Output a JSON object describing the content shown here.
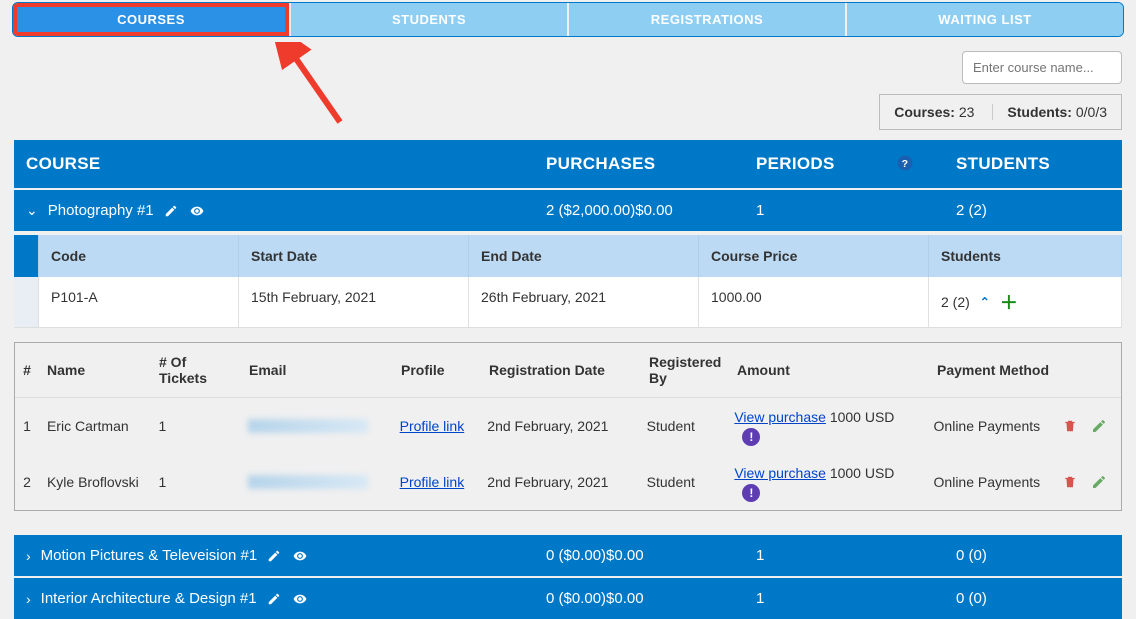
{
  "tabs": {
    "courses": "COURSES",
    "students": "STUDENTS",
    "registrations": "REGISTRATIONS",
    "waiting": "WAITING LIST"
  },
  "search_placeholder": "Enter course name...",
  "stats": {
    "courses_label": "Courses:",
    "courses": "23",
    "students_label": "Students:",
    "students": "0/0/3"
  },
  "headers": {
    "course": "COURSE",
    "purchases": "PURCHASES",
    "periods": "PERIODS",
    "students": "STUDENTS"
  },
  "photo": {
    "name": "Photography #1",
    "purchases": "2 ($2,000.00)$0.00",
    "periods": "1",
    "students": "2 (2)"
  },
  "subhead": {
    "code": "Code",
    "start": "Start Date",
    "end": "End Date",
    "price": "Course Price",
    "students": "Students"
  },
  "subrow": {
    "code": "P101-A",
    "start": "15th February, 2021",
    "end": "26th February, 2021",
    "price": "1000.00",
    "students": "2 (2)"
  },
  "inner_head": {
    "num": "#",
    "name": "Name",
    "tix": "# Of Tickets",
    "email": "Email",
    "profile": "Profile",
    "date": "Registration Date",
    "by": "Registered By",
    "amount": "Amount",
    "pay": "Payment Method"
  },
  "rows": [
    {
      "num": "1",
      "name": "Eric Cartman",
      "tix": "1",
      "profile_link": "Profile link",
      "date": "2nd February, 2021",
      "by": "Student",
      "view": "View purchase",
      "amt": "1000 USD",
      "pay": "Online Payments"
    },
    {
      "num": "2",
      "name": "Kyle Broflovski",
      "tix": "1",
      "profile_link": "Profile link",
      "date": "2nd February, 2021",
      "by": "Student",
      "view": "View purchase",
      "amt": "1000 USD",
      "pay": "Online Payments"
    }
  ],
  "motion": {
    "name": "Motion Pictures & Televeision #1",
    "purchases": "0 ($0.00)$0.00",
    "periods": "1",
    "students": "0 (0)"
  },
  "interior": {
    "name": "Interior Architecture & Design #1",
    "purchases": "0 ($0.00)$0.00",
    "periods": "1",
    "students": "0 (0)"
  }
}
